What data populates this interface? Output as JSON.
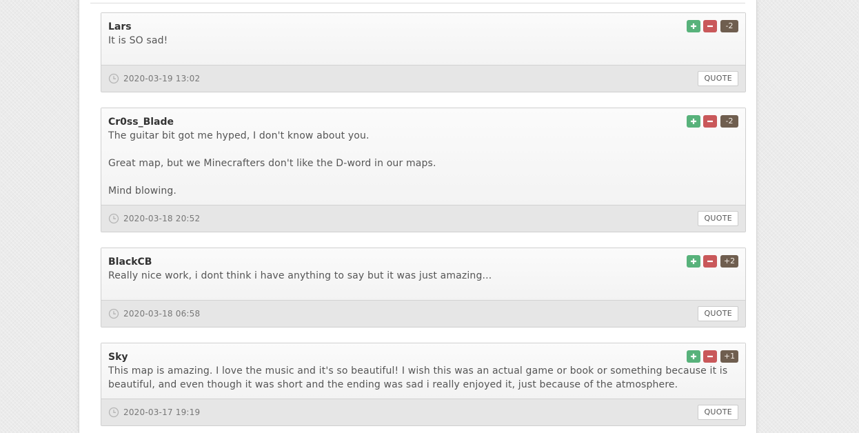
{
  "comments": [
    {
      "author": "Lars",
      "paragraphs": [
        "It is SO sad!"
      ],
      "score": "-2",
      "date": "2020-03-19 13:02",
      "quote_label": "QUOTE"
    },
    {
      "author": "Cr0ss_Blade",
      "paragraphs": [
        "The guitar bit got me hyped, I don't know about you.",
        "Great map, but we Minecrafters don't like the D-word in our maps.",
        "Mind blowing."
      ],
      "score": "-2",
      "date": "2020-03-18 20:52",
      "quote_label": "QUOTE"
    },
    {
      "author": "BlackCB",
      "paragraphs": [
        "Really nice work, i dont think i have anything to say but it was just amazing..."
      ],
      "score": "+2",
      "date": "2020-03-18 06:58",
      "quote_label": "QUOTE"
    },
    {
      "author": "Sky",
      "paragraphs": [
        "This map is amazing. I love the music and it's so beautiful! I wish this was an actual game or book or something because it is beautiful, and even though it was short and the ending was sad i really enjoyed it, just because of the atmosphere."
      ],
      "score": "+1",
      "date": "2020-03-17 19:19",
      "quote_label": "QUOTE"
    }
  ],
  "icons": {
    "vote_up": "plus-icon",
    "vote_down": "minus-icon",
    "timestamp": "clock-icon"
  },
  "colors": {
    "vote_up": "#58b27b",
    "vote_down": "#c9585a",
    "score_badge": "#6f5e4f"
  }
}
